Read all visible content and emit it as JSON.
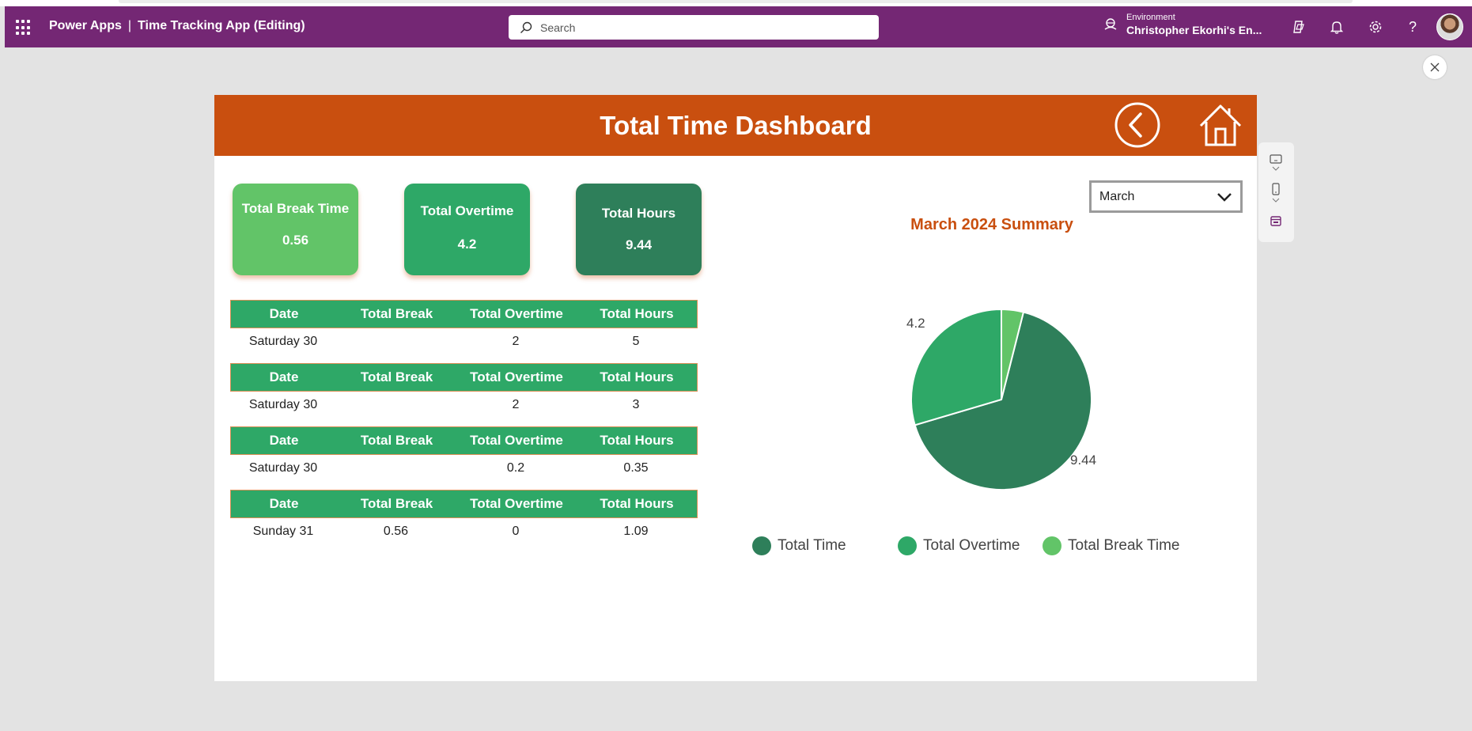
{
  "appbar": {
    "product": "Power Apps",
    "separator": "|",
    "app_name": "Time Tracking App (Editing)",
    "search_placeholder": "Search",
    "environment_label": "Environment",
    "environment_name": "Christopher Ekorhi's En...",
    "icons": [
      "waffle-icon",
      "search-icon",
      "environment-icon",
      "copilot-icon",
      "bell-icon",
      "gear-icon",
      "help-icon",
      "avatar"
    ],
    "help_glyph": "?",
    "color": "#742774"
  },
  "screen": {
    "header_title": "Total Time Dashboard",
    "header_color": "#c94f0f",
    "cards": [
      {
        "label": "Total Break Time",
        "value": "0.56",
        "color": "#62c468"
      },
      {
        "label": "Total Overtime",
        "value": "4.2",
        "color": "#2ea867"
      },
      {
        "label": "Total Hours",
        "value": "9.44",
        "color": "#2e7f5a"
      }
    ],
    "table_headers": [
      "Date",
      "Total Break",
      "Total Overtime",
      "Total Hours"
    ],
    "records": [
      {
        "date": "Saturday 30",
        "break": "",
        "overtime": "2",
        "hours": "5"
      },
      {
        "date": "Saturday 30",
        "break": "",
        "overtime": "2",
        "hours": "3"
      },
      {
        "date": "Saturday 30",
        "break": "",
        "overtime": "0.2",
        "hours": "0.35"
      },
      {
        "date": "Sunday 31",
        "break": "0.56",
        "overtime": "0",
        "hours": "1.09"
      }
    ],
    "month_dropdown": {
      "selected": "March"
    },
    "summary_title": "March 2024 Summary"
  },
  "chart_data": {
    "type": "pie",
    "slices": [
      {
        "name": "Total Time",
        "value": 9.44,
        "color": "#2e7f5a",
        "label": "9.44"
      },
      {
        "name": "Total Overtime",
        "value": 4.2,
        "color": "#2ea867",
        "label": "4.2"
      },
      {
        "name": "Total Break Time",
        "value": 0.56,
        "color": "#62c468",
        "label": ""
      }
    ],
    "legend": [
      "Total Time",
      "Total Overtime",
      "Total Break Time"
    ],
    "legend_position": "bottom"
  }
}
